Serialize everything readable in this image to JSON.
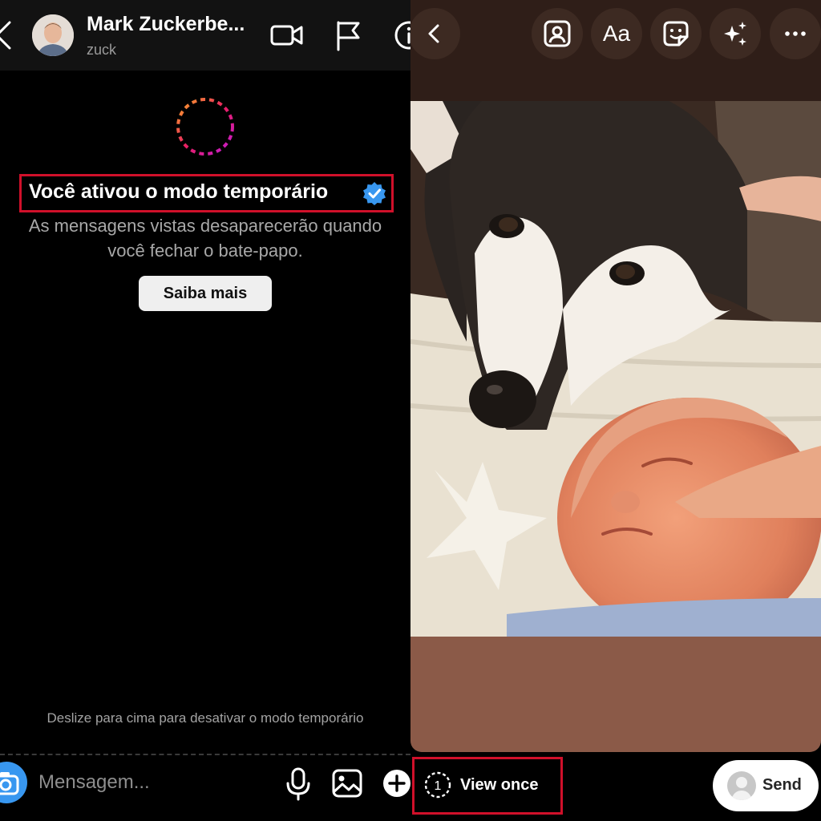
{
  "chat": {
    "header": {
      "name": "Mark Zuckerbe...",
      "handle": "zuck",
      "icons": [
        "back-icon",
        "video-call-icon",
        "flag-icon",
        "info-icon"
      ]
    },
    "vanish_mode": {
      "title": "Você ativou o modo temporário",
      "subtitle_line1": "As mensagens vistas desaparecerão quando",
      "subtitle_line2": "você fechar o bate-papo.",
      "learn_more_label": "Saiba mais",
      "swipe_hint": "Deslize para cima para desativar o modo temporário"
    },
    "composer": {
      "placeholder": "Mensagem...",
      "icons": [
        "camera-icon",
        "microphone-icon",
        "gallery-icon",
        "plus-icon"
      ]
    }
  },
  "editor": {
    "toolbar_icons": [
      "back-icon",
      "mention-icon",
      "text-icon",
      "sticker-icon",
      "effects-icon",
      "more-icon"
    ],
    "text_tool_label": "Aa",
    "view_once": {
      "count": "1",
      "label": "View once"
    },
    "send_label": "Send"
  },
  "colors": {
    "highlight_red": "#d0102a",
    "verified_blue": "#3897f0",
    "editor_bg": "#2f1e18",
    "photo_bottom_fill": "#8b5a48"
  }
}
